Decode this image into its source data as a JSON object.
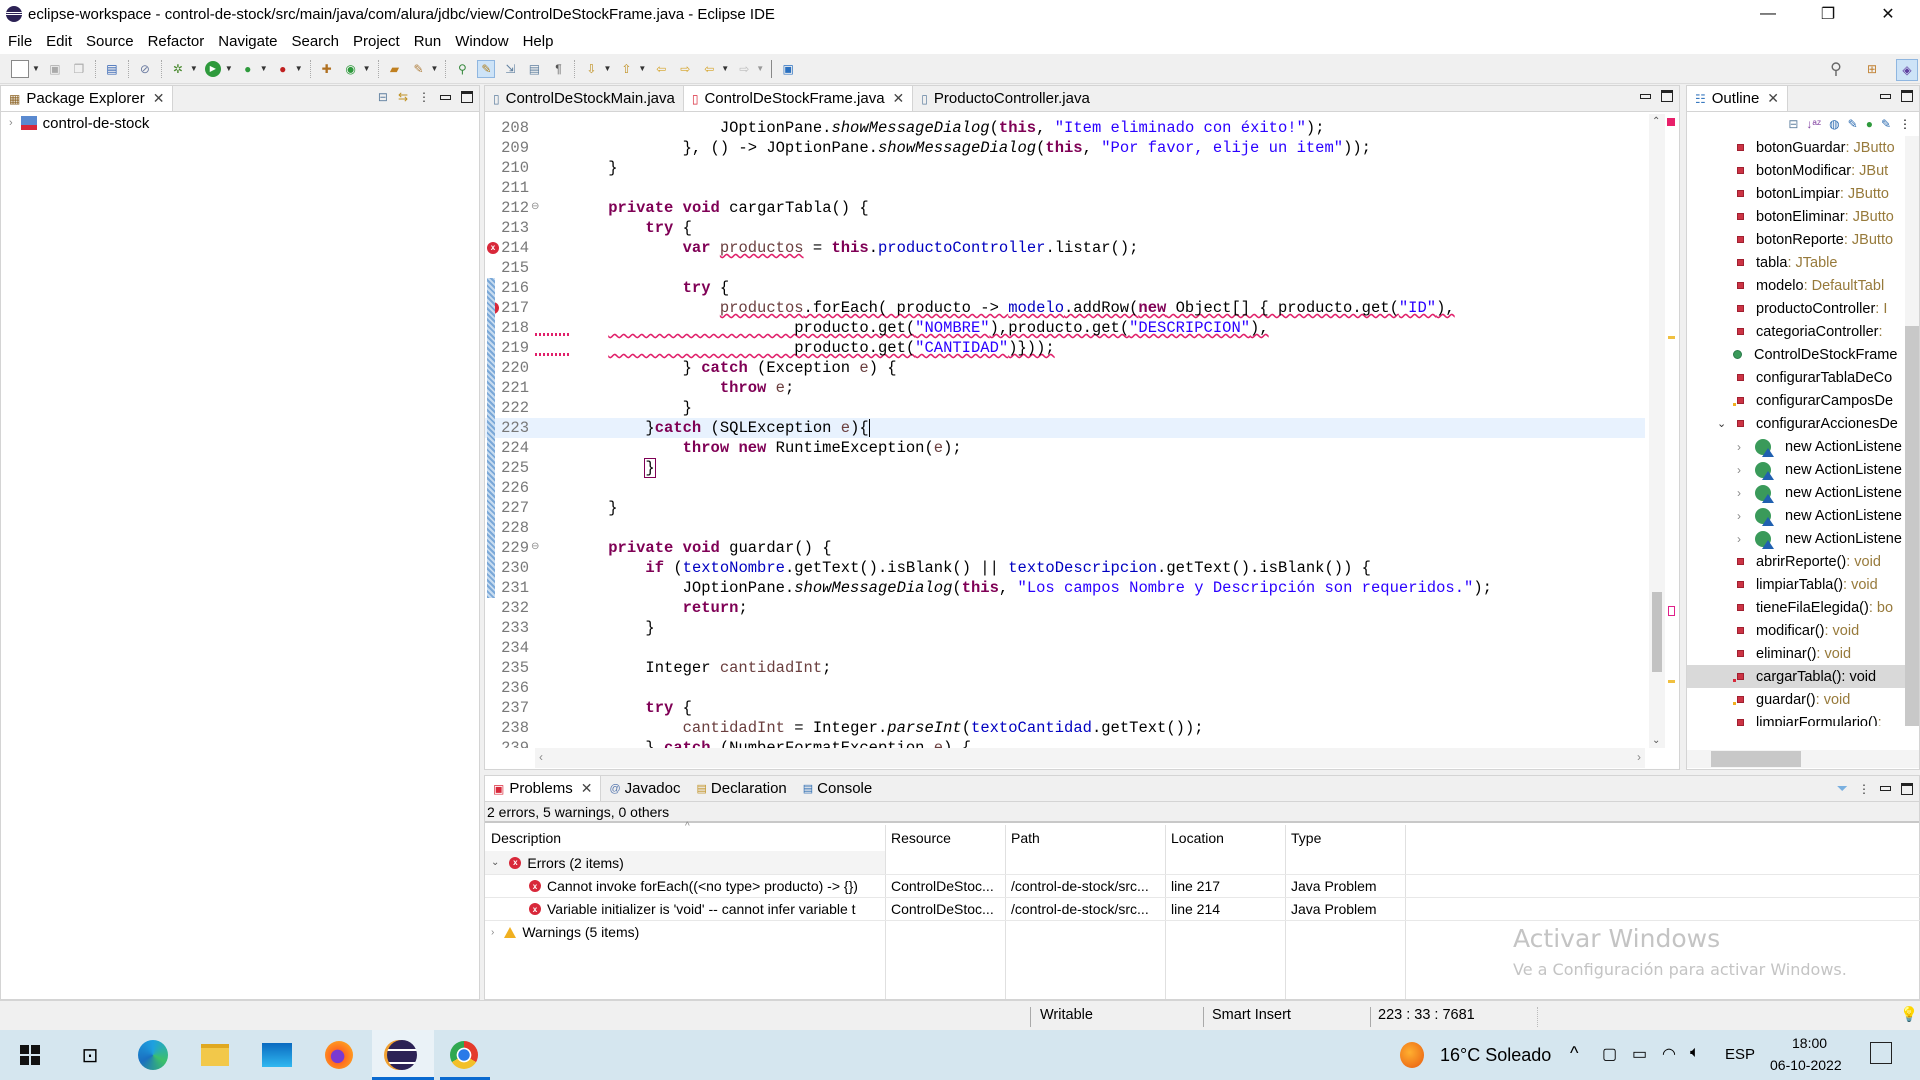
{
  "window": {
    "title": "eclipse-workspace - control-de-stock/src/main/java/com/alura/jdbc/view/ControlDeStockFrame.java - Eclipse IDE",
    "minimize": "—",
    "restore": "❐",
    "close": "✕"
  },
  "menu": [
    "File",
    "Edit",
    "Source",
    "Refactor",
    "Navigate",
    "Search",
    "Project",
    "Run",
    "Window",
    "Help"
  ],
  "package_explorer": {
    "title": "Package Explorer",
    "project": "control-de-stock"
  },
  "editor": {
    "tabs": [
      {
        "label": "ControlDeStockMain.java",
        "active": false
      },
      {
        "label": "ControlDeStockFrame.java",
        "active": true
      },
      {
        "label": "ProductoController.java",
        "active": false
      }
    ],
    "lines": [
      {
        "n": "208",
        "html": "            JOptionPane.<span class=\"it\">showMessageDialog</span>(<span class=\"kw\">this</span>, <span class=\"str\">\"Item eliminado con éxito!\"</span>);"
      },
      {
        "n": "209",
        "html": "        }, () -&gt; JOptionPane.<span class=\"it\">showMessageDialog</span>(<span class=\"kw\">this</span>, <span class=\"str\">\"Por favor, elije un item\"</span>));"
      },
      {
        "n": "210",
        "html": "}"
      },
      {
        "n": "211",
        "html": ""
      },
      {
        "n": "212",
        "html": "<span class=\"kw\">private</span> <span class=\"kw\">void</span> cargarTabla() {",
        "fold": true
      },
      {
        "n": "213",
        "html": "    <span class=\"kw\">try</span> {"
      },
      {
        "n": "214",
        "html": "        <span class=\"kw\">var</span> <span class=\"loc err\">productos</span> = <span class=\"kw\">this</span>.<span class=\"fld\">productoController</span>.listar();",
        "error": true
      },
      {
        "n": "215",
        "html": ""
      },
      {
        "n": "216",
        "html": "        <span class=\"kw\">try</span> {"
      },
      {
        "n": "217",
        "html": "            <span class=\"err\"><span class=\"loc\">productos</span>.forEach( producto -&gt; <span class=\"fld\">modelo</span>.addRow(<span class=\"kw\">new</span> Object[] { producto.get(<span class=\"str\">\"ID\"</span>),</span>",
        "error": true
      },
      {
        "n": "218",
        "html": "<span class=\"err\">                    producto.get(<span class=\"str\">\"NOMBRE\"</span>),producto.get(<span class=\"str\">\"DESCRIPCION\"</span>),</span>",
        "wavy_full": true
      },
      {
        "n": "219",
        "html": "<span class=\"err\">                    producto.get(<span class=\"str\">\"CANTIDAD\"</span>)}));</span>",
        "wavy_full": true
      },
      {
        "n": "220",
        "html": "        } <span class=\"kw\">catch</span> (Exception <span class=\"loc\">e</span>) {"
      },
      {
        "n": "221",
        "html": "            <span class=\"kw\">throw</span> <span class=\"loc\">e</span>;"
      },
      {
        "n": "222",
        "html": "        }"
      },
      {
        "n": "223",
        "html": "    }<span class=\"kw\">catch</span> (SQLException <span class=\"loc\">e</span>){<span style=\"border-left:1.5px solid #000\"></span>",
        "current": true
      },
      {
        "n": "224",
        "html": "        <span class=\"kw\">throw</span> <span class=\"kw\">new</span> RuntimeException(<span class=\"loc\">e</span>);"
      },
      {
        "n": "225",
        "html": "    <span style=\"outline:1px solid #7f0055\">}</span>"
      },
      {
        "n": "226",
        "html": ""
      },
      {
        "n": "227",
        "html": "}"
      },
      {
        "n": "228",
        "html": ""
      },
      {
        "n": "229",
        "html": "<span class=\"kw\">private</span> <span class=\"kw\">void</span> guardar() {",
        "fold": true
      },
      {
        "n": "230",
        "html": "    <span class=\"kw\">if</span> (<span class=\"fld\">textoNombre</span>.getText().isBlank() || <span class=\"fld\">textoDescripcion</span>.getText().isBlank()) {"
      },
      {
        "n": "231",
        "html": "        JOptionPane.<span class=\"it\">showMessageDialog</span>(<span class=\"kw\">this</span>, <span class=\"str\">\"Los campos Nombre y Descripción son requeridos.\"</span>);"
      },
      {
        "n": "232",
        "html": "        <span class=\"kw\">return</span>;"
      },
      {
        "n": "233",
        "html": "    }"
      },
      {
        "n": "234",
        "html": ""
      },
      {
        "n": "235",
        "html": "    Integer <span class=\"loc\">cantidadInt</span>;"
      },
      {
        "n": "236",
        "html": ""
      },
      {
        "n": "237",
        "html": "    <span class=\"kw\">try</span> {"
      },
      {
        "n": "238",
        "html": "        <span class=\"loc\">cantidadInt</span> = Integer.<span class=\"it\">parseInt</span>(<span class=\"fld\">textoCantidad</span>.getText());"
      },
      {
        "n": "239",
        "html": "    } <span class=\"kw\">catch</span> (NumberFormatException <span class=\"loc\">e</span>) {"
      }
    ]
  },
  "outline": {
    "title": "Outline",
    "items": [
      {
        "name": "botonGuardar",
        "type": " : JButto",
        "kind": "field",
        "indent": 0
      },
      {
        "name": "botonModificar",
        "type": " : JBut",
        "kind": "field",
        "indent": 0
      },
      {
        "name": "botonLimpiar",
        "type": " : JButto",
        "kind": "field",
        "indent": 0
      },
      {
        "name": "botonEliminar",
        "type": " : JButto",
        "kind": "field",
        "indent": 0
      },
      {
        "name": "botonReporte",
        "type": " : JButto",
        "kind": "field",
        "indent": 0
      },
      {
        "name": "tabla",
        "type": " : JTable",
        "kind": "field",
        "indent": 0
      },
      {
        "name": "modelo",
        "type": " : DefaultTabl",
        "kind": "field",
        "indent": 0
      },
      {
        "name": "productoController",
        "type": " : I",
        "kind": "field",
        "indent": 0
      },
      {
        "name": "categoriaController",
        "type": " :",
        "kind": "field",
        "indent": 0
      },
      {
        "name": "ControlDeStockFrame",
        "type": "",
        "kind": "constructor",
        "indent": 0
      },
      {
        "name": "configurarTablaDeCo",
        "type": "",
        "kind": "method",
        "indent": 0
      },
      {
        "name": "configurarCamposDe",
        "type": "",
        "kind": "method-warn",
        "indent": 0
      },
      {
        "name": "configurarAccionesDe",
        "type": "",
        "kind": "method",
        "indent": 0,
        "expanded": true
      },
      {
        "name": "new ActionListene",
        "type": "",
        "kind": "anon",
        "indent": 1
      },
      {
        "name": "new ActionListene",
        "type": "",
        "kind": "anon",
        "indent": 1
      },
      {
        "name": "new ActionListene",
        "type": "",
        "kind": "anon",
        "indent": 1
      },
      {
        "name": "new ActionListene",
        "type": "",
        "kind": "anon",
        "indent": 1
      },
      {
        "name": "new ActionListene",
        "type": "",
        "kind": "anon",
        "indent": 1
      },
      {
        "name": "abrirReporte()",
        "type": " : void",
        "kind": "method",
        "indent": 0
      },
      {
        "name": "limpiarTabla()",
        "type": " : void",
        "kind": "method",
        "indent": 0
      },
      {
        "name": "tieneFilaElegida()",
        "type": " : bo",
        "kind": "method",
        "indent": 0
      },
      {
        "name": "modificar()",
        "type": " : void",
        "kind": "method",
        "indent": 0
      },
      {
        "name": "eliminar()",
        "type": " : void",
        "kind": "method",
        "indent": 0
      },
      {
        "name": "cargarTabla()",
        "type": " : void",
        "kind": "method-err",
        "indent": 0,
        "selected": true
      },
      {
        "name": "guardar()",
        "type": " : void",
        "kind": "method-warn",
        "indent": 0
      },
      {
        "name": "limpiarFormulario()",
        "type": " :",
        "kind": "method",
        "indent": 0
      }
    ]
  },
  "problems": {
    "tabs": [
      "Problems",
      "Javadoc",
      "Declaration",
      "Console"
    ],
    "summary": "2 errors, 5 warnings, 0 others",
    "columns": [
      "Description",
      "Resource",
      "Path",
      "Location",
      "Type"
    ],
    "errors_group": "Errors (2 items)",
    "warnings_group": "Warnings (5 items)",
    "rows": [
      {
        "description": "Cannot invoke forEach((<no type> producto) -> {})",
        "resource": "ControlDeStoc...",
        "path": "/control-de-stock/src...",
        "location": "line 217",
        "type": "Java Problem"
      },
      {
        "description": "Variable initializer is 'void' -- cannot infer variable t",
        "resource": "ControlDeStoc...",
        "path": "/control-de-stock/src...",
        "location": "line 214",
        "type": "Java Problem"
      }
    ]
  },
  "watermark": {
    "title": "Activar Windows",
    "subtitle": "Ve a Configuración para activar Windows."
  },
  "status": {
    "writable": "Writable",
    "insert_mode": "Smart Insert",
    "position": "223 : 33 : 7681"
  },
  "taskbar": {
    "weather": "16°C  Soleado",
    "language": "ESP",
    "time": "18:00",
    "date": "06-10-2022"
  }
}
